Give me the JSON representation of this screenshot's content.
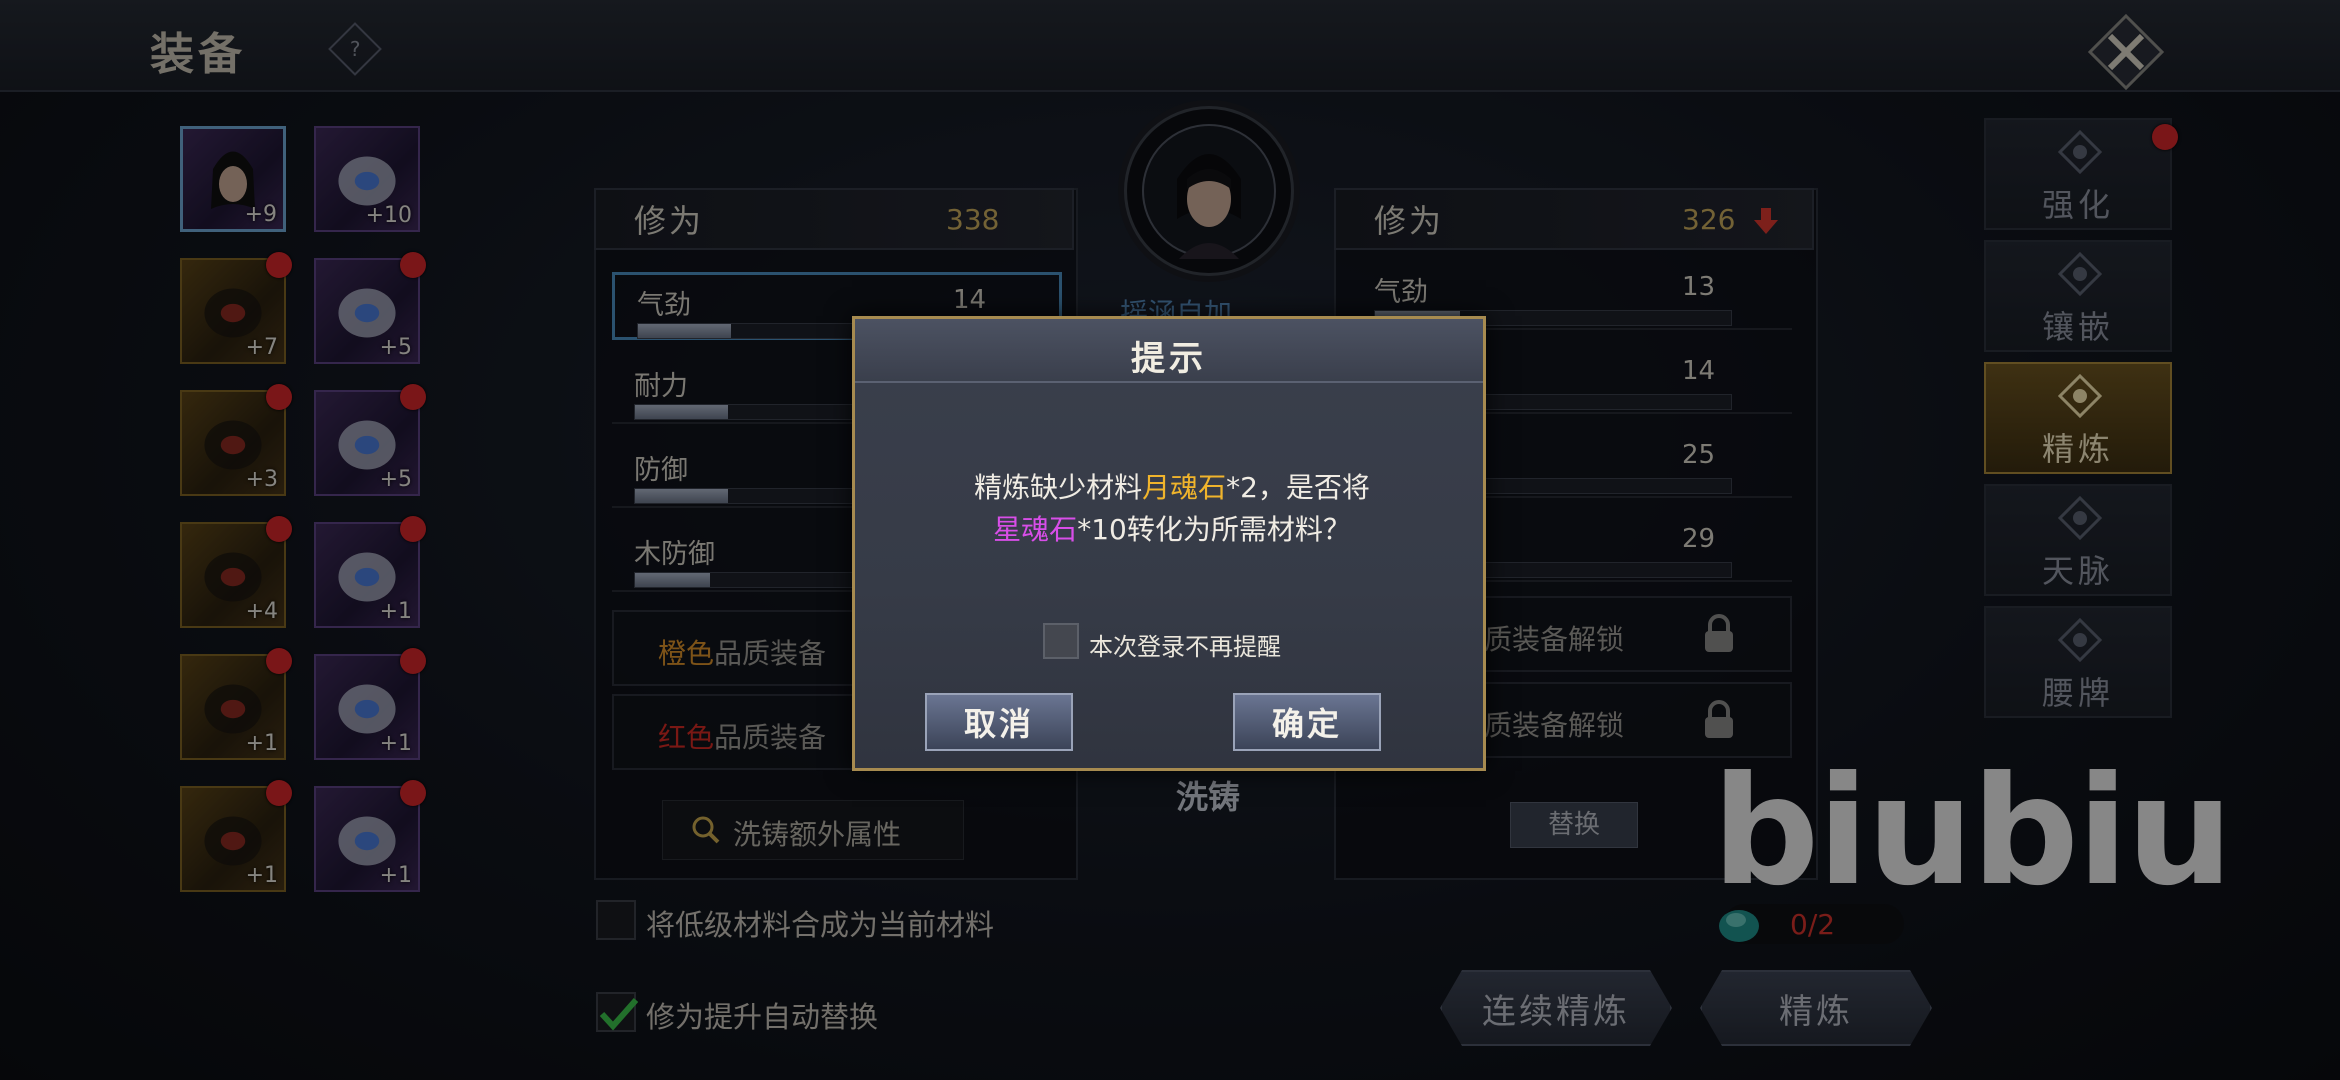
{
  "header": {
    "title": "装备",
    "help_label": "?"
  },
  "slots": [
    {
      "level": "+9",
      "rarity": "purple",
      "selected": true,
      "dot": false
    },
    {
      "level": "+10",
      "rarity": "purple",
      "selected": false,
      "dot": false
    },
    {
      "level": "+7",
      "rarity": "gold",
      "selected": false,
      "dot": true
    },
    {
      "level": "+5",
      "rarity": "purple",
      "selected": false,
      "dot": true
    },
    {
      "level": "+3",
      "rarity": "gold",
      "selected": false,
      "dot": true
    },
    {
      "level": "+5",
      "rarity": "purple",
      "selected": false,
      "dot": true
    },
    {
      "level": "+4",
      "rarity": "gold",
      "selected": false,
      "dot": true
    },
    {
      "level": "+1",
      "rarity": "purple",
      "selected": false,
      "dot": true
    },
    {
      "level": "+1",
      "rarity": "gold",
      "selected": false,
      "dot": true
    },
    {
      "level": "+1",
      "rarity": "purple",
      "selected": false,
      "dot": true
    },
    {
      "level": "+1",
      "rarity": "gold",
      "selected": false,
      "dot": true
    },
    {
      "level": "+1",
      "rarity": "purple",
      "selected": false,
      "dot": true
    }
  ],
  "left_panel": {
    "xiuwei_label": "修为",
    "xiuwei_value": "338",
    "stats": [
      {
        "name": "气劲",
        "value": "14",
        "fill": 0.31
      },
      {
        "name": "耐力",
        "value": "",
        "fill": 0.31
      },
      {
        "name": "防御",
        "value": "",
        "fill": 0.31
      },
      {
        "name": "木防御",
        "value": "",
        "fill": 0.25
      }
    ],
    "unlock_orange_prefix": "橙色",
    "unlock_orange_suffix": "品质装备",
    "unlock_red_prefix": "红色",
    "unlock_red_suffix": "品质装备",
    "search_label": "洗铸额外属性"
  },
  "middle": {
    "partial_label": "摇涵自加",
    "wash_label": "洗铸"
  },
  "right_panel": {
    "xiuwei_label": "修为",
    "xiuwei_value": "326",
    "stats": [
      {
        "name": "气劲",
        "value": "13",
        "fill": 0.24
      },
      {
        "name": "",
        "value": "14",
        "fill": 0.0
      },
      {
        "name": "",
        "value": "25",
        "fill": 0.0
      },
      {
        "name": "",
        "value": "29",
        "fill": 0.0
      }
    ],
    "unlock_1": "质装备解锁",
    "unlock_2": "质装备解锁",
    "replace_label": "替换"
  },
  "tabs": [
    {
      "label": "强化",
      "active": false,
      "dot": true
    },
    {
      "label": "镶嵌",
      "active": false,
      "dot": false
    },
    {
      "label": "精炼",
      "active": true,
      "dot": false
    },
    {
      "label": "天脉",
      "active": false,
      "dot": false
    },
    {
      "label": "腰牌",
      "active": false,
      "dot": false
    }
  ],
  "bottom": {
    "combine_label": "将低级材料合成为当前材料",
    "auto_replace_label": "修为提升自动替换",
    "material_count": "0/2",
    "continuous_button": "连续精炼",
    "refine_button": "精炼"
  },
  "dialog": {
    "title": "提示",
    "msg_part1": "精炼缺少材料",
    "msg_item1": "月魂石",
    "msg_part2": "*2，是否将",
    "msg_item2": "星魂石",
    "msg_part3": "*10转化为所需材料？",
    "dont_remind_label": "本次登录不再提醒",
    "cancel_label": "取消",
    "confirm_label": "确定"
  },
  "watermark": "biubiu",
  "colors": {
    "accent_gold": "#f0b42c",
    "accent_purple": "#d84ee8",
    "badge_red": "#d3262a",
    "down_arrow": "#d8372f"
  }
}
